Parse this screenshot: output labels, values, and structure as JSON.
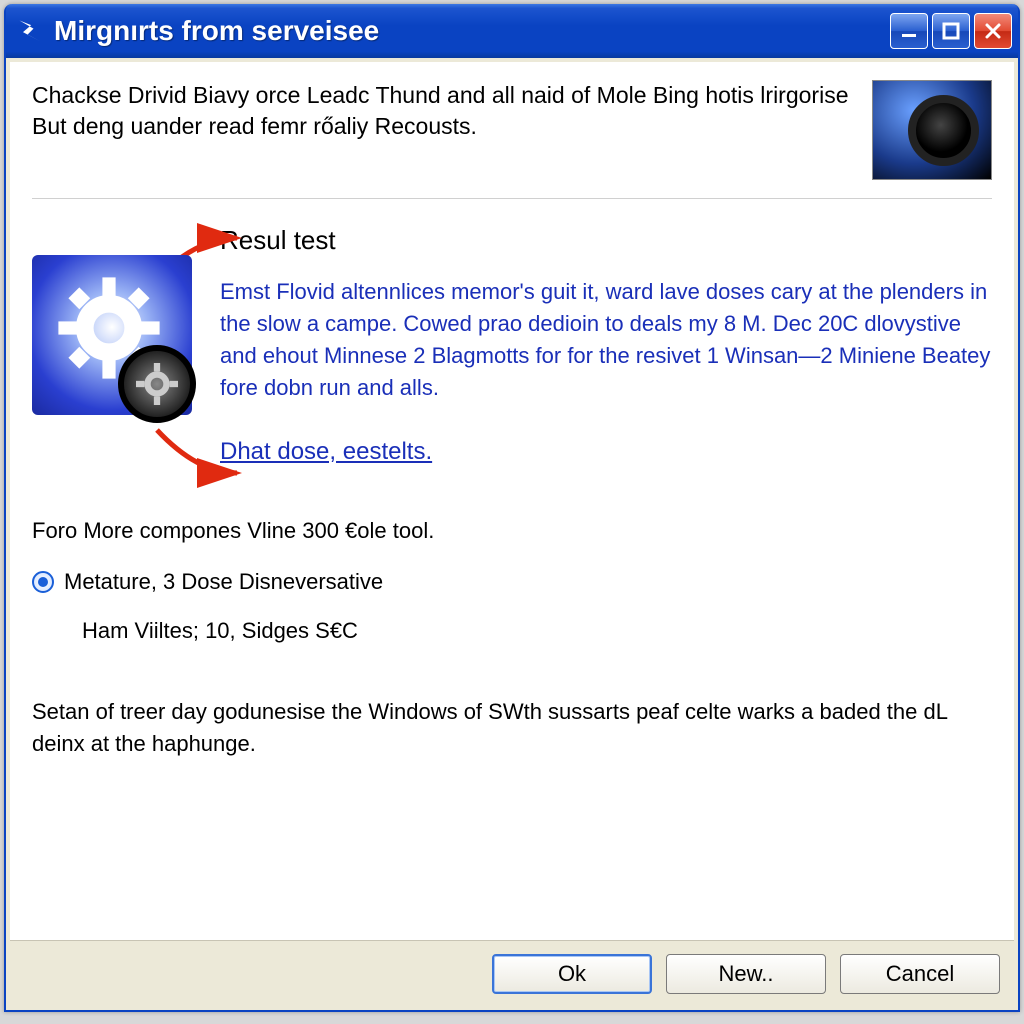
{
  "window": {
    "title": "Mirgnırts from serveisee"
  },
  "header": {
    "text": "Chackse Drivid Biavy orce Leadc Thund and all naid of Mole Bing hotis lrirgorise But deng uander read femr rőaliy Recousts."
  },
  "section": {
    "title": "Resul test",
    "description": "Emst Flovid altennlices memor's guit it, ward lave doses cary at the plenders in the slow a campe. Cowed prao dedioin to deals my 8 M. Dec 20C dlovystive and ehout Minnese 2 Blagmotts for for the resivet 1 Winsan—2 Miniene Beatey fore dobn run and alls.",
    "link": "Dhat dose, eestelts."
  },
  "lower": {
    "intro": "Foro More compones Vline 300 €ole tool.",
    "radio_label": "Metature, 3 Dose Disneversative",
    "detail": "Ham Viiltes; 10, Sidges S€C"
  },
  "footer_text": "Setan of treer day godunesise the Windows of SWth sussarts peaf celte warks a baded the dL deinx at the haphunge.",
  "buttons": {
    "ok": "Ok",
    "new": "New..",
    "cancel": "Cancel"
  }
}
